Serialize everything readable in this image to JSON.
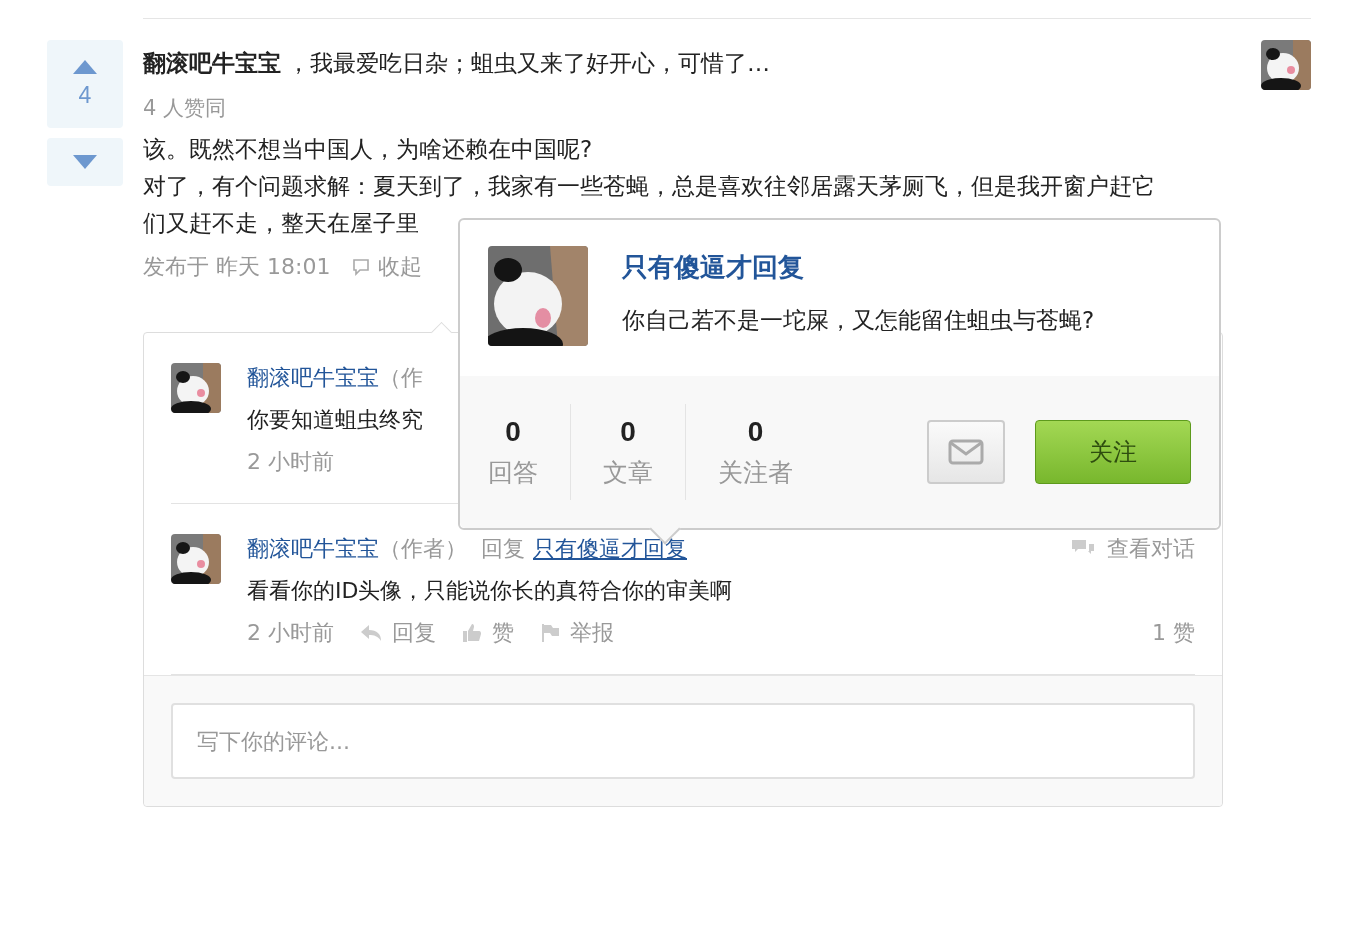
{
  "vote": {
    "count": "4"
  },
  "answer": {
    "author": "翻滚吧牛宝宝",
    "signature": "，我最爱吃日杂；蛆虫又来了好开心，可惜了…",
    "agree": "4 人赞同",
    "lines": [
      "该。既然不想当中国人，为啥还赖在中国呢?",
      "对了，有个问题求解：夏天到了，我家有一些苍蝇，总是喜欢往邻居露天茅厕飞，但是我开窗户赶它",
      "们又赶不走，整天在屋子里"
    ],
    "published": "发布于 昨天 18:01",
    "collapse": "收起"
  },
  "comments": [
    {
      "author": "翻滚吧牛宝宝",
      "role": "（作",
      "body": "你要知道蛆虫终究",
      "time": "2 小时前"
    },
    {
      "author": "翻滚吧牛宝宝",
      "role": "（作者）",
      "reply_word": "回复",
      "reply_to": "只有傻逼才回复",
      "view": "查看对话",
      "body": "看看你的ID头像，只能说你长的真符合你的审美啊",
      "time": "2 小时前",
      "actions": [
        {
          "kind": "reply",
          "label": "回复"
        },
        {
          "kind": "like",
          "label": "赞"
        },
        {
          "kind": "report",
          "label": "举报"
        }
      ],
      "likes": "1 赞"
    }
  ],
  "comment_input": {
    "placeholder": "写下你的评论..."
  },
  "popup": {
    "name": "只有傻逼才回复",
    "bio": "你自己若不是一坨屎，又怎能留住蛆虫与苍蝇?",
    "stats": [
      {
        "value": "0",
        "label": "回答"
      },
      {
        "value": "0",
        "label": "文章"
      },
      {
        "value": "0",
        "label": "关注者"
      }
    ],
    "follow": "关注"
  }
}
